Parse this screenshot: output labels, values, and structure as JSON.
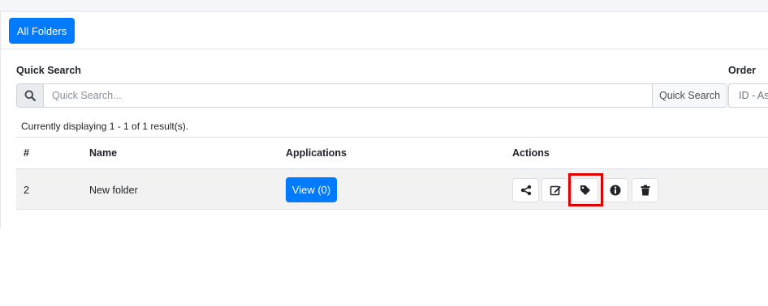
{
  "header": {
    "all_folders_label": "All Folders"
  },
  "search": {
    "label": "Quick Search",
    "placeholder": "Quick Search...",
    "button_label": "Quick Search",
    "search_icon": "search-icon"
  },
  "order": {
    "label": "Order",
    "select_value": "ID - Ascending"
  },
  "status_text": "Currently displaying 1 - 1 of 1 result(s).",
  "table": {
    "columns": [
      "#",
      "Name",
      "Applications",
      "Actions"
    ],
    "rows": [
      {
        "id": "2",
        "name": "New folder",
        "applications_label": "View (0)"
      }
    ],
    "actions": [
      "share-icon",
      "edit-icon",
      "tag-icon",
      "info-icon",
      "trash-icon"
    ]
  },
  "colors": {
    "primary": "#007bff",
    "highlight": "#e00000"
  }
}
